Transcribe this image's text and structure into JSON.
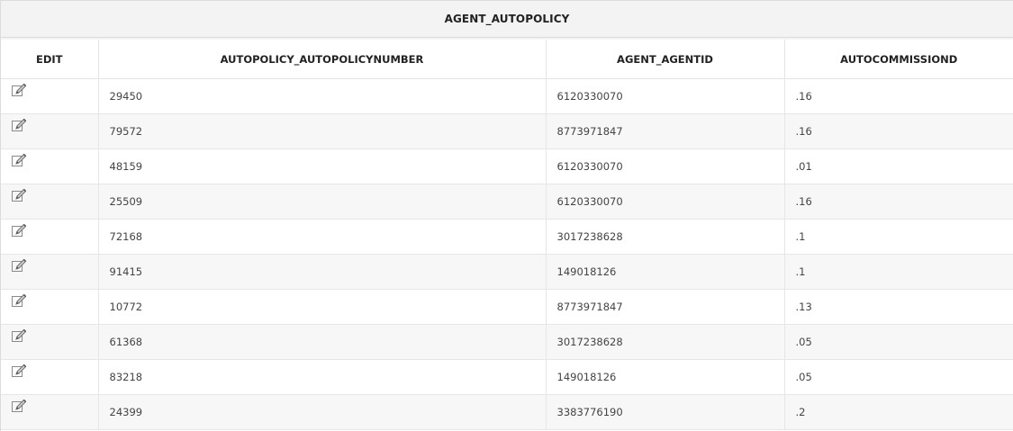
{
  "table": {
    "title": "AGENT_AUTOPOLICY",
    "columns": [
      "EDIT",
      "AUTOPOLICY_AUTOPOLICYNUMBER",
      "AGENT_AGENTID",
      "AUTOCOMMISSIOND"
    ],
    "rows": [
      {
        "policy_number": "29450",
        "agent_id": "6120330070",
        "commission": ".16"
      },
      {
        "policy_number": "79572",
        "agent_id": "8773971847",
        "commission": ".16"
      },
      {
        "policy_number": "48159",
        "agent_id": "6120330070",
        "commission": ".01"
      },
      {
        "policy_number": "25509",
        "agent_id": "6120330070",
        "commission": ".16"
      },
      {
        "policy_number": "72168",
        "agent_id": "3017238628",
        "commission": ".1"
      },
      {
        "policy_number": "91415",
        "agent_id": "149018126",
        "commission": ".1"
      },
      {
        "policy_number": "10772",
        "agent_id": "8773971847",
        "commission": ".13"
      },
      {
        "policy_number": "61368",
        "agent_id": "3017238628",
        "commission": ".05"
      },
      {
        "policy_number": "83218",
        "agent_id": "149018126",
        "commission": ".05"
      },
      {
        "policy_number": "24399",
        "agent_id": "3383776190",
        "commission": ".2"
      }
    ],
    "row_icon": "edit-pencil-icon"
  },
  "colors": {
    "title_bg": "#f3f3f3",
    "row_alt_bg": "#f7f7f7",
    "border": "#e6e6e6",
    "text": "#444444"
  }
}
